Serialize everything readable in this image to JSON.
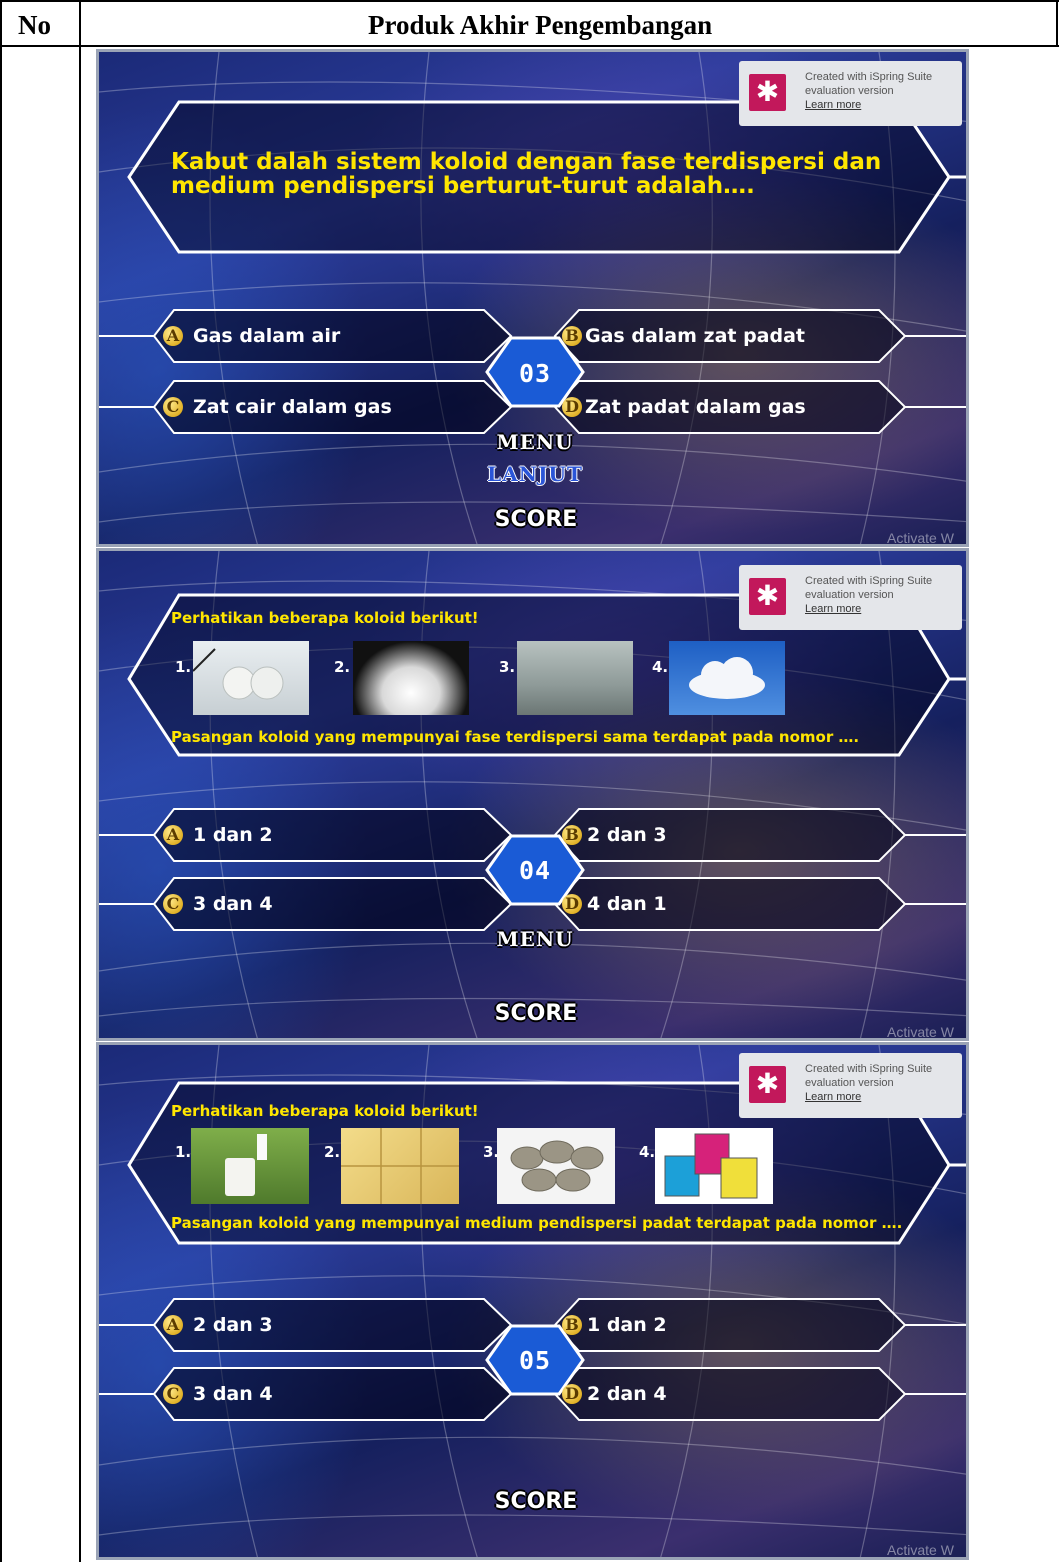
{
  "table": {
    "header_no": "No",
    "header_title": "Produk Akhir Pengembangan"
  },
  "watermark": {
    "line1": "Created with iSpring Suite",
    "line2": "evaluation version",
    "link": "Learn more"
  },
  "activate_text": "Activate W",
  "buttons": {
    "menu": "MENU",
    "lanjut": "LANJUT",
    "score": "SCORE"
  },
  "slides": [
    {
      "question_lines": [
        "Kabut dalah sistem koloid dengan fase terdispersi dan",
        "medium pendispersi berturut-turut adalah…."
      ],
      "number": "03",
      "answers": [
        {
          "letter": "A",
          "text": "Gas dalam air"
        },
        {
          "letter": "B",
          "text": "Gas dalam zat padat"
        },
        {
          "letter": "C",
          "text": "Zat cair dalam gas"
        },
        {
          "letter": "D",
          "text": "Zat padat dalam gas"
        }
      ]
    },
    {
      "intro": "Perhatikan beberapa koloid  berikut!",
      "images": [
        {
          "num": "1.",
          "subject": "pearls"
        },
        {
          "num": "2.",
          "subject": "smoke"
        },
        {
          "num": "3.",
          "subject": "fog"
        },
        {
          "num": "4.",
          "subject": "cloud"
        }
      ],
      "question": "Pasangan koloid yang mempunyai fase terdispersi sama terdapat pada nomor ….",
      "number": "04",
      "answers": [
        {
          "letter": "A",
          "text": "1 dan 2"
        },
        {
          "letter": "B",
          "text": "2 dan 3"
        },
        {
          "letter": "C",
          "text": "3 dan 4"
        },
        {
          "letter": "D",
          "text": "4 dan 1"
        }
      ]
    },
    {
      "intro": "Perhatikan beberapa koloid  berikut!",
      "images": [
        {
          "num": "1.",
          "subject": "milk"
        },
        {
          "num": "2.",
          "subject": "butter"
        },
        {
          "num": "3.",
          "subject": "pumice stones"
        },
        {
          "num": "4.",
          "subject": "paint cans"
        }
      ],
      "question": "Pasangan koloid yang mempunyai medium pendispersi padat terdapat pada nomor ….",
      "number": "05",
      "answers": [
        {
          "letter": "A",
          "text": "2 dan 3"
        },
        {
          "letter": "B",
          "text": "1 dan 2"
        },
        {
          "letter": "C",
          "text": "3 dan 4"
        },
        {
          "letter": "D",
          "text": "2 dan 4"
        }
      ]
    }
  ]
}
